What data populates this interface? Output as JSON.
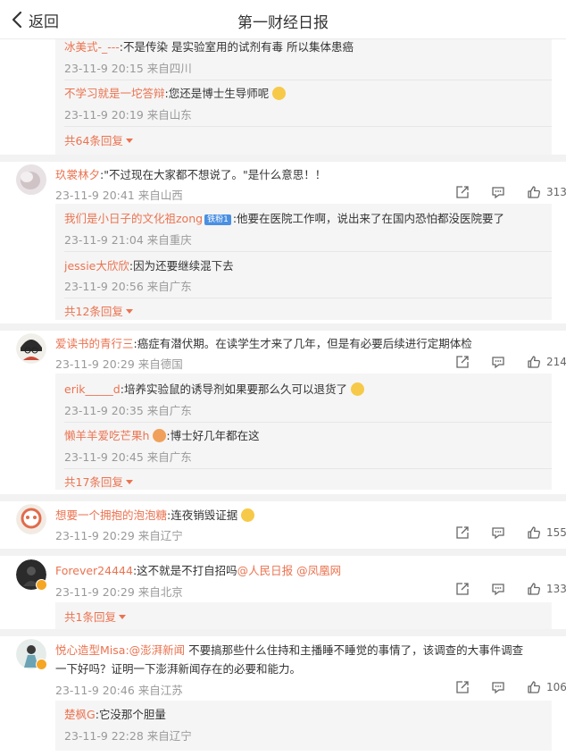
{
  "header": {
    "back_label": "返回",
    "title": "第一财经日报"
  },
  "thread0": {
    "replies": [
      {
        "name": "冰美式-_---",
        "text": ":不是传染 是实验室用的试剂有毒 所以集体患癌",
        "meta": "23-11-9 20:15 来自四川"
      },
      {
        "name": "不学习就是一坨答辩",
        "text": ":您还是博士生导师呢",
        "meta": "23-11-9 20:19 来自山东"
      }
    ],
    "more": "共64条回复"
  },
  "comments": [
    {
      "name": "玖裳林夕",
      "text": ":\"不过现在大家都不想说了。\"是什么意思！！",
      "meta": "23-11-9 20:41 来自山西",
      "likes": "313",
      "replies": [
        {
          "name": "我们是小日子的文化祖zong",
          "vbadge": "铁粉1",
          "text": ":他要在医院工作啊，说出来了在国内恐怕都没医院要了",
          "meta": "23-11-9 21:04 来自重庆"
        },
        {
          "name": "jessie大欣欣",
          "text": ":因为还要继续混下去",
          "meta": "23-11-9 20:56 来自广东"
        }
      ],
      "more": "共12条回复"
    },
    {
      "name": "爱读书的青行三",
      "text": ":癌症有潜伏期。在读学生才来了几年，但是有必要后续进行定期体检",
      "meta": "23-11-9 20:29 来自德国",
      "likes": "214",
      "replies": [
        {
          "name": "erik_____d",
          "text": ":培养实验鼠的诱导剂如果要那么久可以退货了",
          "meta": "23-11-9 20:35 来自广东"
        },
        {
          "name": "懒羊羊爱吃芒果h",
          "text": ":博士好几年都在这",
          "meta": "23-11-9 20:45 来自广东"
        }
      ],
      "more": "共17条回复"
    },
    {
      "name": "想要一个拥抱的泡泡糖",
      "text": ":连夜销毁证据",
      "meta": "23-11-9 20:29 来自辽宁",
      "likes": "155"
    },
    {
      "name": "Forever24444",
      "text": ":这不就是不打自招吗",
      "mention1": "@人民日报",
      "mention2": "@凤凰网",
      "meta": "23-11-9 20:29 来自北京",
      "likes": "133",
      "more": "共1条回复"
    },
    {
      "name": "悦心造型Misa",
      "mention": ":@澎湃新闻",
      "text1": " 不要搞那些什么住持和主播睡不睡觉的事情了，该调查的大事件调查",
      "text2": "一下好吗？证明一下澎湃新闻存在的必要和能力。",
      "meta": "23-11-9 20:46 来自江苏",
      "likes": "106",
      "replies": [
        {
          "name": "楚枫G",
          "text": ":它没那个胆量",
          "meta": "23-11-9 22:28 来自辽宁"
        }
      ]
    }
  ],
  "colors": {
    "accent": "#eb7350",
    "meta": "#999999",
    "reply_bg": "#f5f5f5"
  },
  "icons": {
    "share": "share-icon",
    "comment": "comment-icon",
    "like": "thumb-up-icon",
    "back": "chevron-left-icon"
  }
}
